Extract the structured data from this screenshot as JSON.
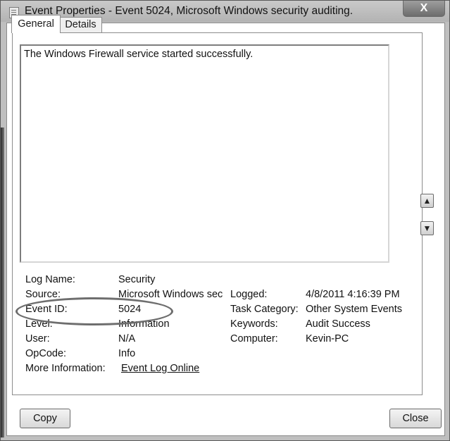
{
  "window": {
    "title": "Event Properties - Event 5024, Microsoft Windows security auditing.",
    "close_glyph": "X"
  },
  "tabs": [
    {
      "label": "General",
      "active": true
    },
    {
      "label": "Details",
      "active": false
    }
  ],
  "message": "The Windows Firewall service started successfully.",
  "left_props": [
    {
      "label": "Log Name:",
      "value": "Security"
    },
    {
      "label": "Source:",
      "value": "Microsoft Windows sec"
    },
    {
      "label": "Event ID:",
      "value": "5024"
    },
    {
      "label": "Level:",
      "value": "Information"
    },
    {
      "label": "User:",
      "value": "N/A"
    },
    {
      "label": "OpCode:",
      "value": "Info"
    },
    {
      "label": "More Information:",
      "value": "Event Log Online"
    }
  ],
  "right_props": [
    {
      "label": "Logged:",
      "value": "4/8/2011 4:16:39 PM"
    },
    {
      "label": "Task Category:",
      "value": "Other System Events"
    },
    {
      "label": "Keywords:",
      "value": "Audit Success"
    },
    {
      "label": "Computer:",
      "value": "Kevin-PC"
    }
  ],
  "buttons": {
    "copy": "Copy",
    "close": "Close",
    "up_arrow": "▲",
    "down_arrow": "▼"
  },
  "annotation": {
    "highlighted_field": "Event ID"
  }
}
